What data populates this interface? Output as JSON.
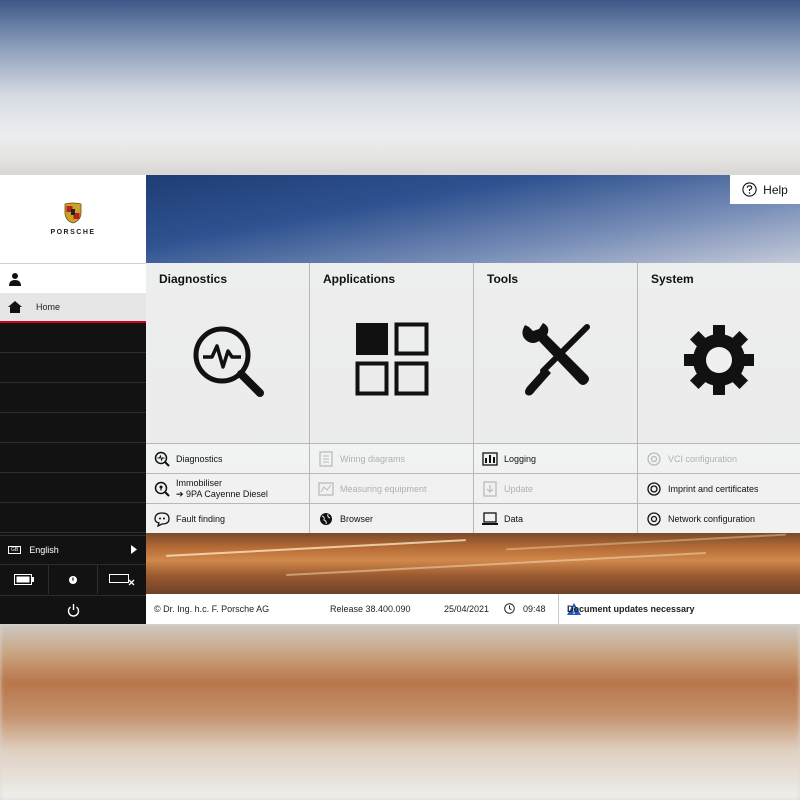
{
  "brand": {
    "wordmark": "PORSCHE"
  },
  "sidebar": {
    "home_label": "Home",
    "language": {
      "code": "GB",
      "label": "English"
    }
  },
  "header": {
    "help_label": "Help"
  },
  "columns": [
    {
      "title": "Diagnostics",
      "icon": "diagnostics-magnifier-icon",
      "links": [
        {
          "label": "Diagnostics",
          "icon": "diagnostics-icon",
          "enabled": true
        },
        {
          "label": "Immobiliser",
          "label2": "➔ 9PA Cayenne Diesel",
          "icon": "immobiliser-icon",
          "enabled": true
        },
        {
          "label": "Fault finding",
          "icon": "fault-finding-icon",
          "enabled": true
        }
      ]
    },
    {
      "title": "Applications",
      "icon": "applications-grid-icon",
      "links": [
        {
          "label": "Wiring diagrams",
          "icon": "wiring-icon",
          "enabled": false
        },
        {
          "label": "Measuring equipment",
          "icon": "measuring-icon",
          "enabled": false
        },
        {
          "label": "Browser",
          "icon": "globe-icon",
          "enabled": true
        }
      ]
    },
    {
      "title": "Tools",
      "icon": "tools-wrench-screwdriver-icon",
      "links": [
        {
          "label": "Logging",
          "icon": "logging-icon",
          "enabled": true
        },
        {
          "label": "Update",
          "icon": "update-icon",
          "enabled": false
        },
        {
          "label": "Data",
          "icon": "data-icon",
          "enabled": true
        }
      ]
    },
    {
      "title": "System",
      "icon": "system-gear-icon",
      "links": [
        {
          "label": "VCI configuration",
          "icon": "vci-icon",
          "enabled": false
        },
        {
          "label": "Imprint and certificates",
          "icon": "imprint-icon",
          "enabled": true
        },
        {
          "label": "Network configuration",
          "icon": "network-icon",
          "enabled": true
        }
      ]
    }
  ],
  "footer": {
    "copyright": "© Dr. Ing. h.c. F. Porsche AG",
    "release": "Release 38.400.090",
    "date": "25/04/2021",
    "time": "09:48",
    "notice": "Document updates necessary"
  },
  "colors": {
    "accent": "#d5001c",
    "sidebar_bg": "#121212",
    "notice_icon": "#1f5ac8"
  }
}
